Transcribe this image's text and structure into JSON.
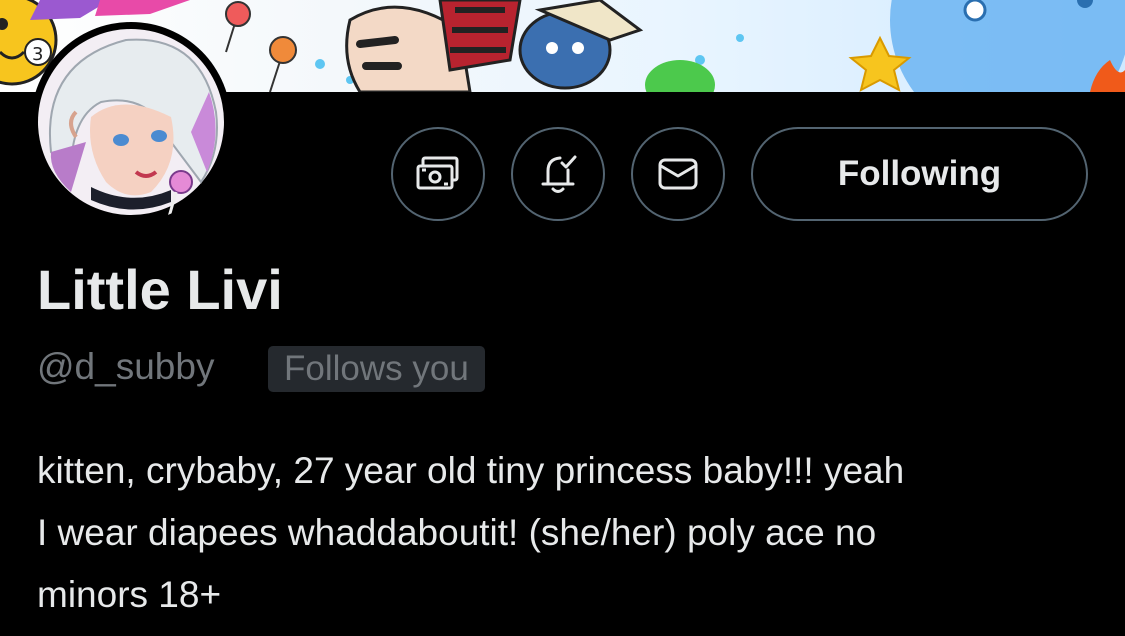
{
  "banner": {
    "visible_number": "3"
  },
  "actions": {
    "tip_icon": "money-icon",
    "notify_icon": "bell-check-icon",
    "message_icon": "envelope-icon",
    "follow_label": "Following"
  },
  "profile": {
    "display_name": "Little Livi",
    "handle": "@d_subby",
    "follows_you": "Follows you",
    "bio_line1": "kitten, crybaby, 27 year old tiny princess baby!!! yeah",
    "bio_line2": "I wear diapees whaddaboutit! (she/her) poly ace no",
    "bio_line3": "minors 18+"
  },
  "colors": {
    "background": "#000000",
    "primary_text": "#e7e9ea",
    "secondary_text": "#71767b",
    "border": "#536471",
    "badge_bg": "#25292e"
  }
}
